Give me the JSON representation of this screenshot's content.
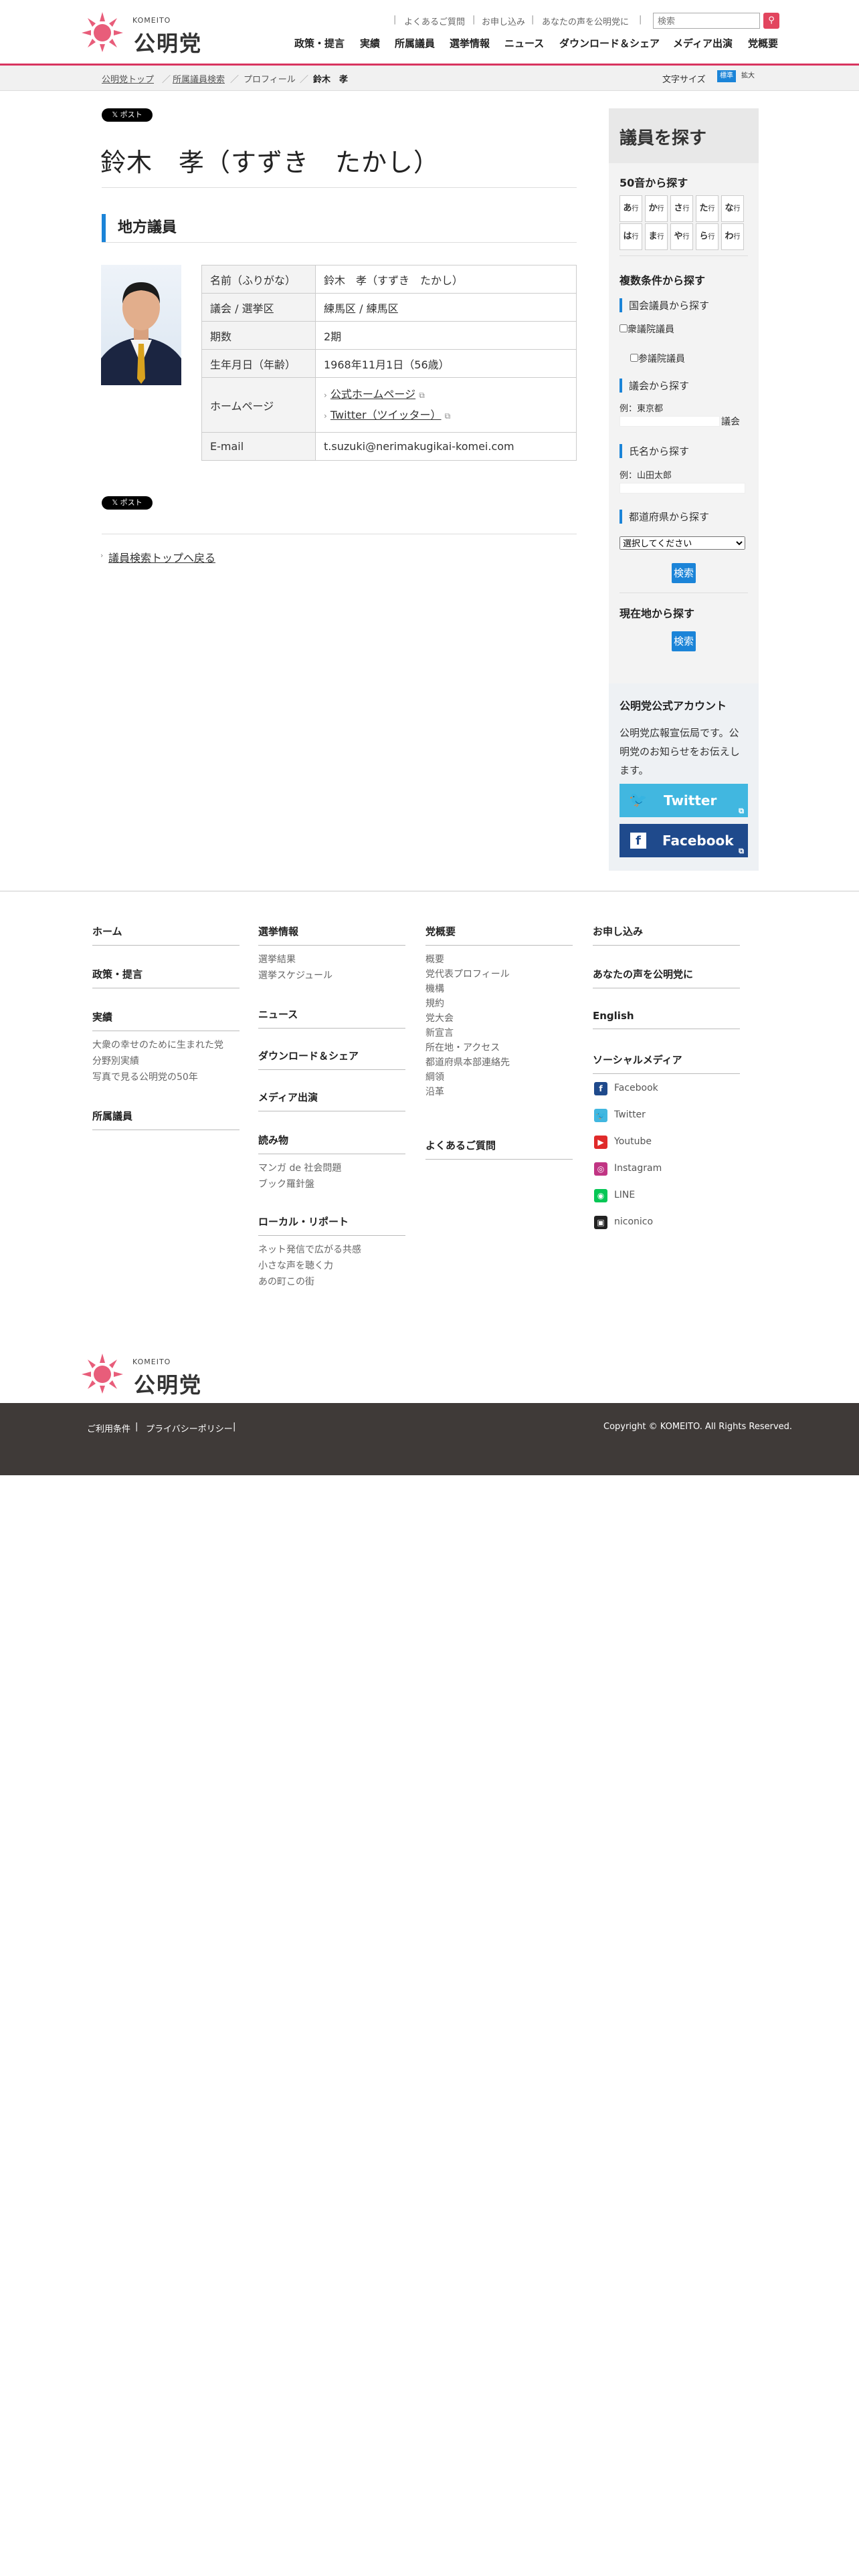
{
  "header": {
    "logo_en": "KOMEITO",
    "logo_ja": "公明党",
    "util_links": [
      "よくあるご質問",
      "お申し込み",
      "あなたの声を公明党に"
    ],
    "search_placeholder": "検索",
    "search_icon": "search-icon",
    "nav": [
      "政策・提言",
      "実績",
      "所属議員",
      "選挙情報",
      "ニュース",
      "ダウンロード＆シェア",
      "メディア出演",
      "党概要"
    ]
  },
  "breadcrumb": {
    "items": [
      "公明党トップ",
      "所属議員検索",
      "プロフィール",
      "鈴木　孝"
    ],
    "font_size_label": "文字サイズ",
    "font_std": "標準",
    "font_large": "拡大"
  },
  "main": {
    "share_label": "𝕏 ポスト",
    "title": "鈴木　孝（すずき　たかし）",
    "section_title": "地方議員",
    "profile": [
      {
        "key": "名前（ふりがな）",
        "value": "鈴木　孝（すずき　たかし）"
      },
      {
        "key": "議会 / 選挙区",
        "value": "練馬区 / 練馬区"
      },
      {
        "key": "期数",
        "value": "2期"
      },
      {
        "key": "生年月日（年齢）",
        "value": "1968年11月1日（56歳）"
      },
      {
        "key": "ホームページ",
        "links": [
          "公式ホームページ",
          "Twitter（ツイッター）"
        ]
      },
      {
        "key": "E-mail",
        "value": "t.suzuki@nerimakugikai-komei.com"
      }
    ],
    "back_link": "議員検索トップへ戻る"
  },
  "sidebar": {
    "title": "議員を探す",
    "kana_head": "50音から探す",
    "kana": [
      "あ",
      "か",
      "さ",
      "た",
      "な",
      "は",
      "ま",
      "や",
      "ら",
      "わ"
    ],
    "kana_suffix": "行",
    "multi_head": "複数条件から探す",
    "national_head": "国会議員から探す",
    "shugiin": "衆議院議員",
    "sangiin": "参議院議員",
    "assembly_head": "議会から探す",
    "assembly_example": "例：東京都",
    "assembly_suffix": "議会",
    "name_head": "氏名から探す",
    "name_example": "例：山田太郎",
    "pref_head": "都道府県から探す",
    "pref_select": "選択してください",
    "search_btn": "検索",
    "location_head": "現在地から探す",
    "account_title": "公明党公式アカウント",
    "account_desc": "公明党広報宣伝局です。公明党のお知らせをお伝えします。",
    "twitter_label": "Twitter",
    "facebook_label": "Facebook",
    "colors": {
      "twitter": "#41b7e0",
      "facebook": "#1f4a8c",
      "accent": "#1b84d8",
      "brand": "#e2455e"
    }
  },
  "footer": {
    "col1": [
      "ホーム",
      "政策・提言",
      "実績",
      "所属議員"
    ],
    "col1_sub": [
      "大衆の幸せのために生まれた党",
      "分野別実績",
      "写真で見る公明党の50年"
    ],
    "col2_heads": [
      "選挙情報",
      "ニュース",
      "ダウンロード＆シェア",
      "メディア出演",
      "読み物",
      "ローカル・リポート"
    ],
    "col2_election": [
      "選挙結果",
      "選挙スケジュール"
    ],
    "col2_reading": [
      "マンガ de 社会問題",
      "ブック羅針盤"
    ],
    "col2_local": [
      "ネット発信で広がる共感",
      "小さな声を聴く力",
      "あの町この街"
    ],
    "col3_head": "党概要",
    "col3": [
      "概要",
      "党代表プロフィール",
      "機構",
      "規約",
      "党大会",
      "新宣言",
      "所在地・アクセス",
      "都道府県本部連絡先",
      "綱領",
      "沿革"
    ],
    "col3_faq": "よくあるご質問",
    "col4_heads": [
      "お申し込み",
      "あなたの声を公明党に",
      "English",
      "ソーシャルメディア"
    ],
    "social": [
      "Facebook",
      "Twitter",
      "Youtube",
      "Instagram",
      "LINE",
      "niconico"
    ],
    "bottom_links": [
      "ご利用条件",
      "プライバシーポリシー"
    ],
    "copyright": "Copyright © KOMEITO. All Rights Reserved."
  }
}
